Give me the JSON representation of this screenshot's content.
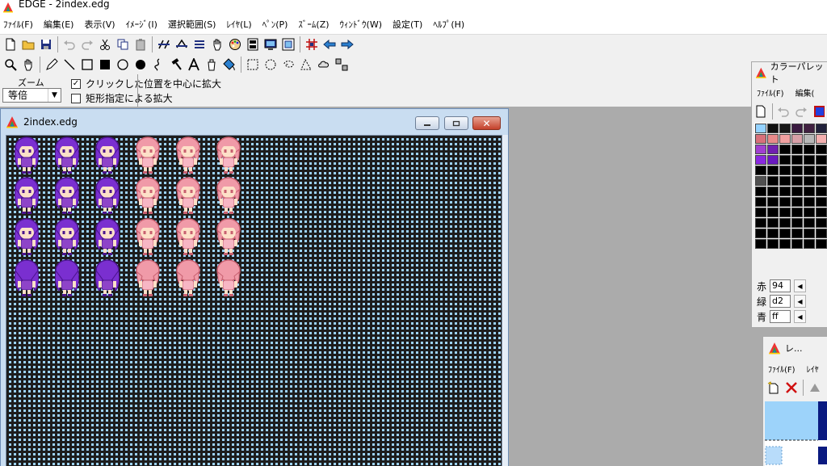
{
  "app": {
    "title": "EDGE - 2index.edg"
  },
  "menu": [
    "ﾌｧｲﾙ(F)",
    "編集(E)",
    "表示(V)",
    "ｲﾒｰｼﾞ(I)",
    "選択範囲(S)",
    "ﾚｲﾔ(L)",
    "ﾍﾟﾝ(P)",
    "ｽﾞｰﾑ(Z)",
    "ｳｨﾝﾄﾞｳ(W)",
    "設定(T)",
    "ﾍﾙﾌﾟ(H)"
  ],
  "zoom_panel": {
    "label": "ズーム",
    "selected": "等倍",
    "option_click_center": "クリックした位置を中心に拡大",
    "option_rect": "矩形指定による拡大",
    "click_center_checked": true,
    "rect_checked": false
  },
  "document": {
    "title": "2index.edg",
    "close_glyph": "✕"
  },
  "palette": {
    "title": "カラーパレット",
    "menu": [
      "ﾌｧｲﾙ(F)",
      "編集("
    ],
    "red_label": "赤",
    "green_label": "緑",
    "blue_label": "青",
    "red_value": "94",
    "green_value": "d2",
    "blue_value": "ff",
    "colors": [
      [
        "#94d2ff",
        "#101010",
        "#161616",
        "#3a1a40",
        "#402040",
        "#20203a",
        "#102040"
      ],
      [
        "#d8707a",
        "#e88a8a",
        "#f0a0a0",
        "#d8a0a8",
        "#b8b8b8",
        "#f4b0b0",
        "#e07878"
      ],
      [
        "#a040d0",
        "#7020b0",
        "#000000",
        "#000000",
        "#000000",
        "#000000",
        "#000000"
      ],
      [
        "#8a2ae0",
        "#6a1ac0",
        "#000000",
        "#000000",
        "#000000",
        "#000000",
        "#000000"
      ],
      [
        "#000000",
        "#000000",
        "#000000",
        "#000000",
        "#000000",
        "#000000",
        "#000000"
      ],
      [
        "#505050",
        "#000000",
        "#000000",
        "#000000",
        "#000000",
        "#000000",
        "#000000"
      ],
      [
        "#000000",
        "#000000",
        "#000000",
        "#000000",
        "#000000",
        "#000000",
        "#000000"
      ]
    ],
    "empty_rows": 5
  },
  "layer": {
    "title": "レ...",
    "menu": [
      "ﾌｧｲﾙ(F)",
      "ﾚｲﾔ"
    ]
  },
  "sprites": {
    "purple_hair": "#7a2fd0",
    "purple_hair_dark": "#4a148c",
    "pink_hair": "#f09aa8",
    "pink_hair_dark": "#c86070",
    "skin": "#fde0c8",
    "purple_outfit": "#8e44c8",
    "pink_outfit": "#f7b6c4"
  }
}
